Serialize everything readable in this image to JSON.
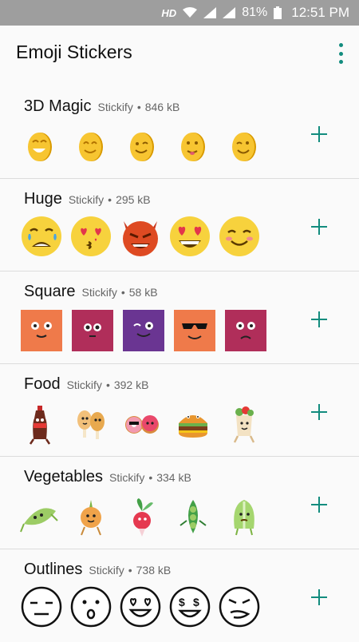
{
  "status": {
    "network": "HD",
    "battery": "81%",
    "time": "12:51 PM"
  },
  "app": {
    "title": "Emoji Stickers"
  },
  "packs": [
    {
      "name": "3D Magic",
      "publisher": "Stickify",
      "size": "846 kB"
    },
    {
      "name": "Huge",
      "publisher": "Stickify",
      "size": "295 kB"
    },
    {
      "name": "Square",
      "publisher": "Stickify",
      "size": "58 kB"
    },
    {
      "name": "Food",
      "publisher": "Stickify",
      "size": "392 kB"
    },
    {
      "name": "Vegetables",
      "publisher": "Stickify",
      "size": "334 kB"
    },
    {
      "name": "Outlines",
      "publisher": "Stickify",
      "size": "738 kB"
    }
  ],
  "colors": {
    "accent": "#128c7e",
    "divider": "#dcdcdc",
    "statusbar": "#9e9e9e"
  }
}
